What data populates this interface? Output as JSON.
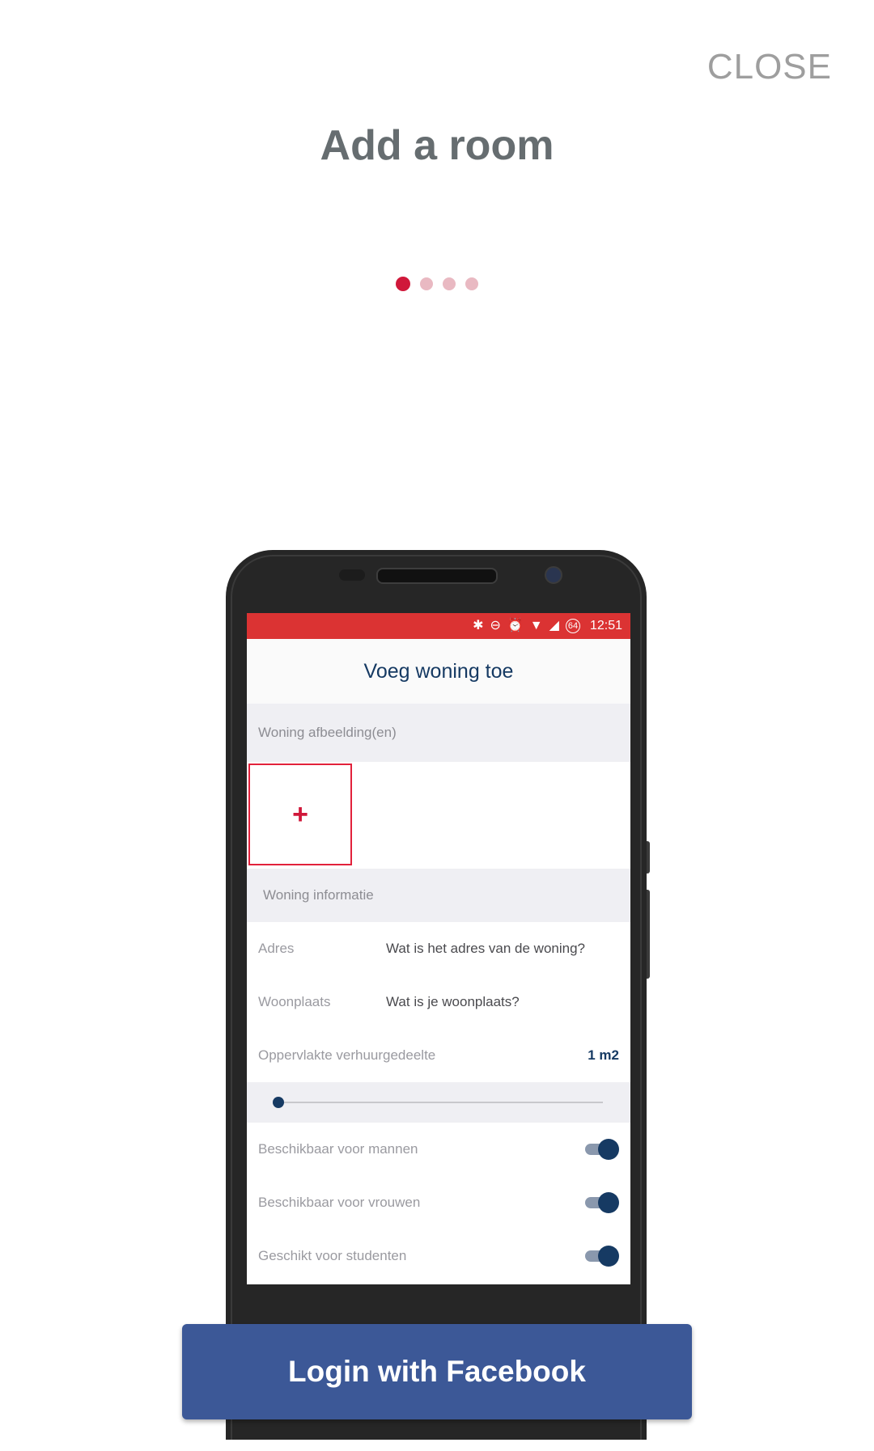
{
  "header": {
    "close_label": "CLOSE",
    "title": "Add a room"
  },
  "pager": {
    "count": 4,
    "active_index": 0
  },
  "phone_screen": {
    "status_bar": {
      "time": "12:51",
      "battery": "64"
    },
    "app_title": "Voeg woning toe",
    "section_images": "Woning afbeelding(en)",
    "add_icon": "+",
    "section_info": "Woning informatie",
    "fields": [
      {
        "label": "Adres",
        "value": "Wat is het adres van de woning?"
      },
      {
        "label": "Woonplaats",
        "value": "Wat is je woonplaats?"
      }
    ],
    "area": {
      "label": "Oppervlakte verhuurgedeelte",
      "value": "1 m2"
    },
    "toggles": [
      {
        "label": "Beschikbaar voor mannen",
        "on": true
      },
      {
        "label": "Beschikbaar voor vrouwen",
        "on": true
      },
      {
        "label": "Geschikt voor studenten",
        "on": true
      }
    ]
  },
  "login_button": {
    "label": "Login with Facebook",
    "color": "#3c5897"
  },
  "colors": {
    "accent": "#d0183a",
    "status_bar": "#db3333",
    "navy": "#163a63"
  }
}
